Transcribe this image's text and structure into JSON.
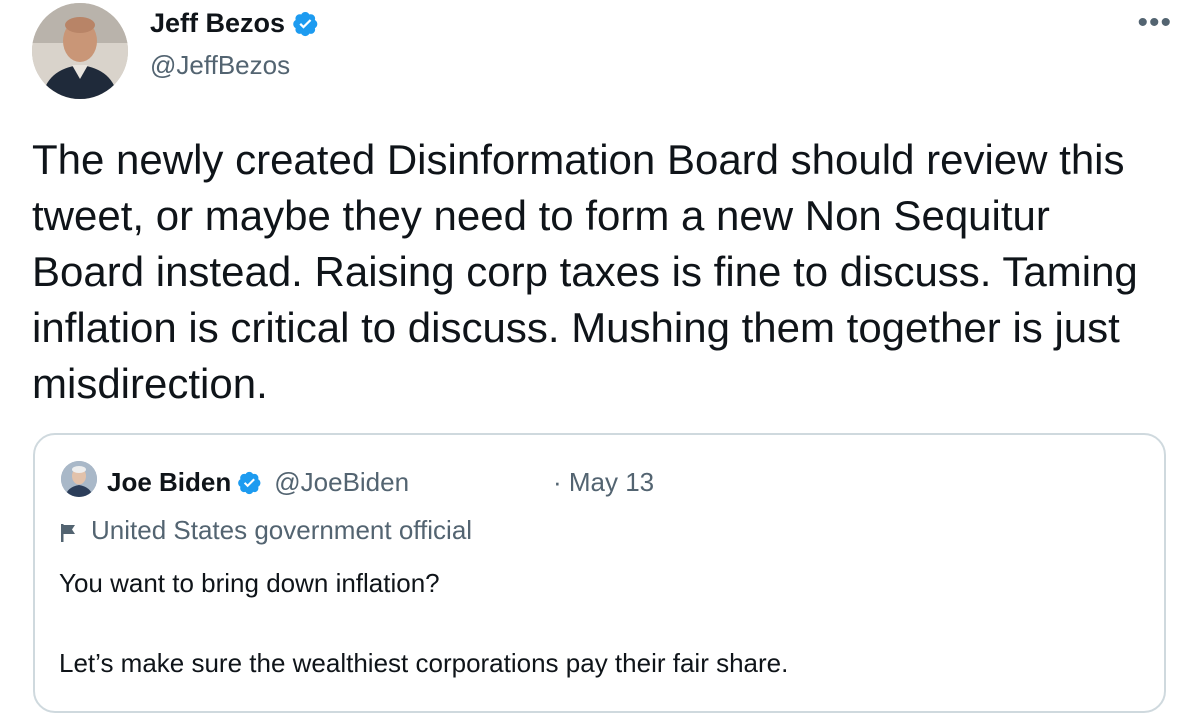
{
  "author": {
    "display_name": "Jeff Bezos",
    "handle": "@JeffBezos",
    "verified_icon": "verified-badge-icon"
  },
  "more_icon": "•••",
  "tweet": {
    "text": "The newly created Disinformation Board should review this tweet, or maybe they need to form a new Non Sequitur Board instead. Raising corp taxes is fine to discuss. Taming inflation is critical to discuss. Mushing them together is just misdirection."
  },
  "quoted_tweet": {
    "display_name": "Joe Biden",
    "handle": "@JoeBiden",
    "date": "· May 13",
    "label": "United States government official",
    "line1": "You want to bring down inflation?",
    "line2": "Let’s make sure the wealthiest corporations pay their fair share."
  },
  "colors": {
    "text_primary": "#0f1419",
    "text_secondary": "#536471",
    "verified_blue": "#1d9bf0",
    "card_border": "#cfd9de"
  }
}
